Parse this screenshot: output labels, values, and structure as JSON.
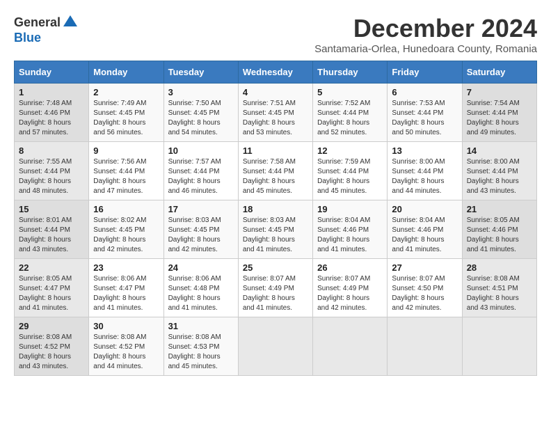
{
  "logo": {
    "general": "General",
    "blue": "Blue"
  },
  "title": "December 2024",
  "subtitle": "Santamaria-Orlea, Hunedoara County, Romania",
  "days": [
    "Sunday",
    "Monday",
    "Tuesday",
    "Wednesday",
    "Thursday",
    "Friday",
    "Saturday"
  ],
  "weeks": [
    [
      {
        "day": "1",
        "sunrise": "7:48 AM",
        "sunset": "4:46 PM",
        "daylight": "8 hours and 57 minutes."
      },
      {
        "day": "2",
        "sunrise": "7:49 AM",
        "sunset": "4:45 PM",
        "daylight": "8 hours and 56 minutes."
      },
      {
        "day": "3",
        "sunrise": "7:50 AM",
        "sunset": "4:45 PM",
        "daylight": "8 hours and 54 minutes."
      },
      {
        "day": "4",
        "sunrise": "7:51 AM",
        "sunset": "4:45 PM",
        "daylight": "8 hours and 53 minutes."
      },
      {
        "day": "5",
        "sunrise": "7:52 AM",
        "sunset": "4:44 PM",
        "daylight": "8 hours and 52 minutes."
      },
      {
        "day": "6",
        "sunrise": "7:53 AM",
        "sunset": "4:44 PM",
        "daylight": "8 hours and 50 minutes."
      },
      {
        "day": "7",
        "sunrise": "7:54 AM",
        "sunset": "4:44 PM",
        "daylight": "8 hours and 49 minutes."
      }
    ],
    [
      {
        "day": "8",
        "sunrise": "7:55 AM",
        "sunset": "4:44 PM",
        "daylight": "8 hours and 48 minutes."
      },
      {
        "day": "9",
        "sunrise": "7:56 AM",
        "sunset": "4:44 PM",
        "daylight": "8 hours and 47 minutes."
      },
      {
        "day": "10",
        "sunrise": "7:57 AM",
        "sunset": "4:44 PM",
        "daylight": "8 hours and 46 minutes."
      },
      {
        "day": "11",
        "sunrise": "7:58 AM",
        "sunset": "4:44 PM",
        "daylight": "8 hours and 45 minutes."
      },
      {
        "day": "12",
        "sunrise": "7:59 AM",
        "sunset": "4:44 PM",
        "daylight": "8 hours and 45 minutes."
      },
      {
        "day": "13",
        "sunrise": "8:00 AM",
        "sunset": "4:44 PM",
        "daylight": "8 hours and 44 minutes."
      },
      {
        "day": "14",
        "sunrise": "8:00 AM",
        "sunset": "4:44 PM",
        "daylight": "8 hours and 43 minutes."
      }
    ],
    [
      {
        "day": "15",
        "sunrise": "8:01 AM",
        "sunset": "4:44 PM",
        "daylight": "8 hours and 43 minutes."
      },
      {
        "day": "16",
        "sunrise": "8:02 AM",
        "sunset": "4:45 PM",
        "daylight": "8 hours and 42 minutes."
      },
      {
        "day": "17",
        "sunrise": "8:03 AM",
        "sunset": "4:45 PM",
        "daylight": "8 hours and 42 minutes."
      },
      {
        "day": "18",
        "sunrise": "8:03 AM",
        "sunset": "4:45 PM",
        "daylight": "8 hours and 41 minutes."
      },
      {
        "day": "19",
        "sunrise": "8:04 AM",
        "sunset": "4:46 PM",
        "daylight": "8 hours and 41 minutes."
      },
      {
        "day": "20",
        "sunrise": "8:04 AM",
        "sunset": "4:46 PM",
        "daylight": "8 hours and 41 minutes."
      },
      {
        "day": "21",
        "sunrise": "8:05 AM",
        "sunset": "4:46 PM",
        "daylight": "8 hours and 41 minutes."
      }
    ],
    [
      {
        "day": "22",
        "sunrise": "8:05 AM",
        "sunset": "4:47 PM",
        "daylight": "8 hours and 41 minutes."
      },
      {
        "day": "23",
        "sunrise": "8:06 AM",
        "sunset": "4:47 PM",
        "daylight": "8 hours and 41 minutes."
      },
      {
        "day": "24",
        "sunrise": "8:06 AM",
        "sunset": "4:48 PM",
        "daylight": "8 hours and 41 minutes."
      },
      {
        "day": "25",
        "sunrise": "8:07 AM",
        "sunset": "4:49 PM",
        "daylight": "8 hours and 41 minutes."
      },
      {
        "day": "26",
        "sunrise": "8:07 AM",
        "sunset": "4:49 PM",
        "daylight": "8 hours and 42 minutes."
      },
      {
        "day": "27",
        "sunrise": "8:07 AM",
        "sunset": "4:50 PM",
        "daylight": "8 hours and 42 minutes."
      },
      {
        "day": "28",
        "sunrise": "8:08 AM",
        "sunset": "4:51 PM",
        "daylight": "8 hours and 43 minutes."
      }
    ],
    [
      {
        "day": "29",
        "sunrise": "8:08 AM",
        "sunset": "4:52 PM",
        "daylight": "8 hours and 43 minutes."
      },
      {
        "day": "30",
        "sunrise": "8:08 AM",
        "sunset": "4:52 PM",
        "daylight": "8 hours and 44 minutes."
      },
      {
        "day": "31",
        "sunrise": "8:08 AM",
        "sunset": "4:53 PM",
        "daylight": "8 hours and 45 minutes."
      },
      null,
      null,
      null,
      null
    ]
  ]
}
